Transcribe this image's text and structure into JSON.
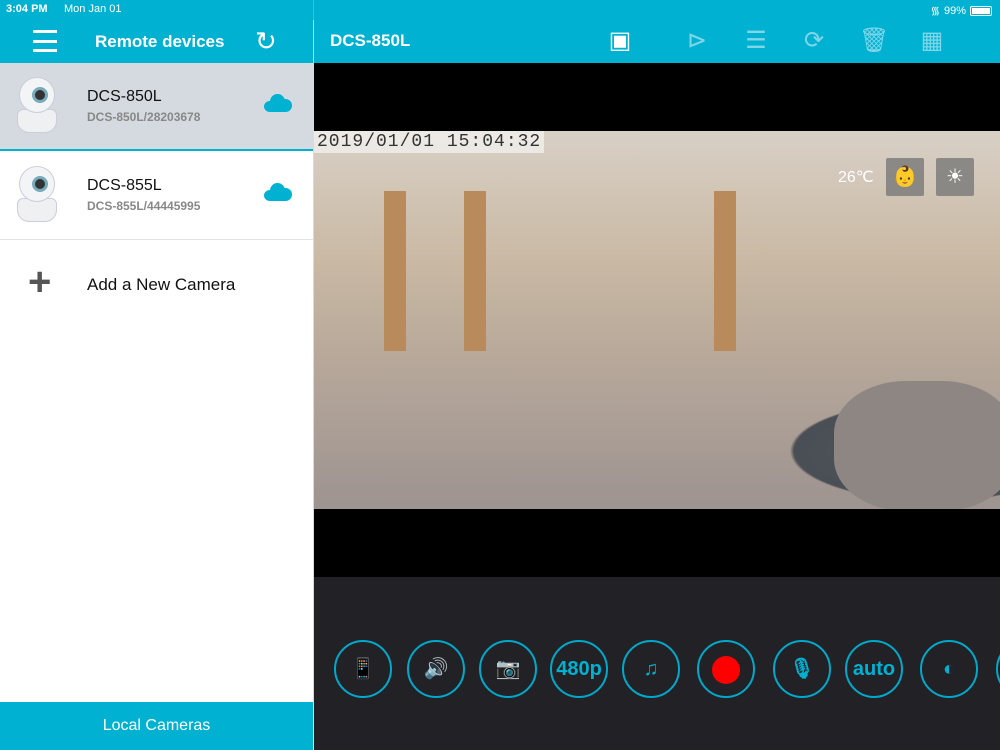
{
  "status_bar": {
    "time": "3:04 PM",
    "date": "Mon Jan 01",
    "battery": "99%",
    "battery_level": 0.99
  },
  "sidebar": {
    "title": "Remote devices",
    "devices": [
      {
        "name": "DCS-850L",
        "id": "DCS-850L/28203678",
        "selected": true
      },
      {
        "name": "DCS-855L",
        "id": "DCS-855L/44445995",
        "selected": false
      }
    ],
    "add_label": "Add a New Camera",
    "footer_label": "Local Cameras"
  },
  "main": {
    "title": "DCS-850L",
    "video": {
      "timestamp": "2019/01/01 15:04:32",
      "temperature": "26℃"
    },
    "controls": {
      "resolution": "480p",
      "mode": "auto"
    }
  },
  "colors": {
    "accent": "#00b1d2",
    "record": "#ff0000",
    "controls_bg": "#222226"
  }
}
